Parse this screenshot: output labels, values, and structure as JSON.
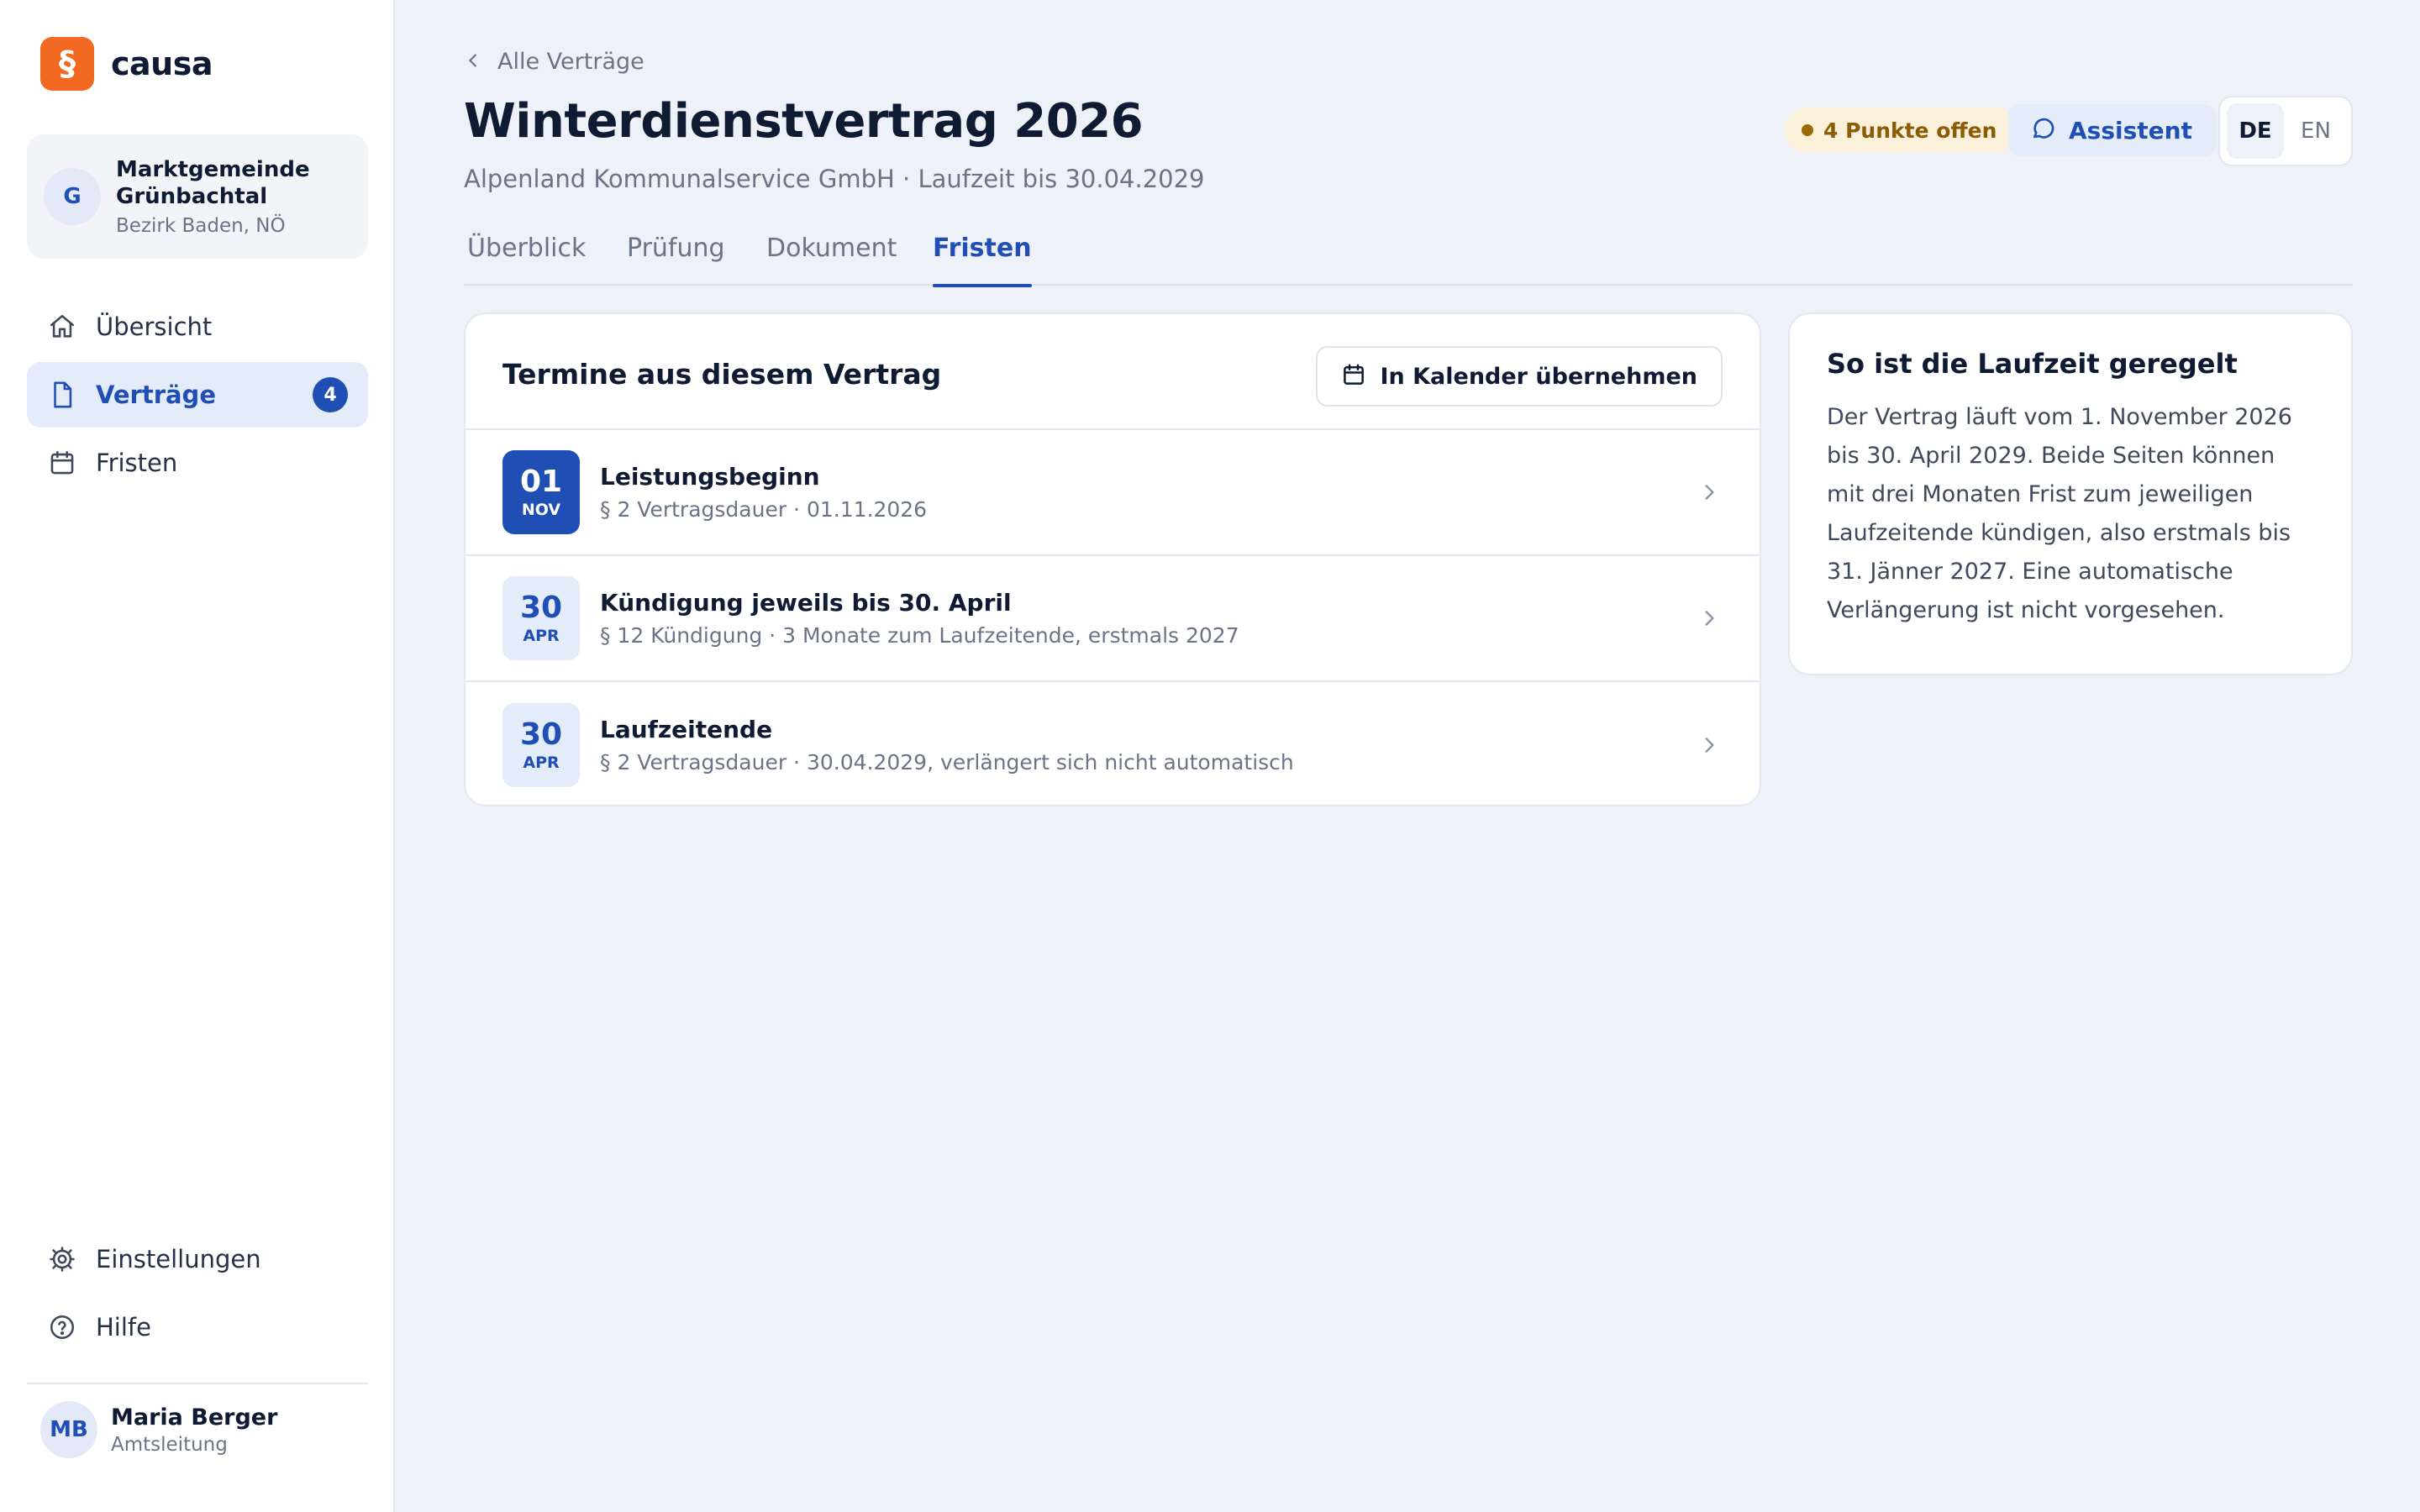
{
  "brand": {
    "mark": "§",
    "name": "causa",
    "accent": "#f26a21"
  },
  "org": {
    "initial": "G",
    "name": "Marktgemeinde Grünbachtal",
    "region": "Bezirk Baden, NÖ"
  },
  "nav": {
    "items": [
      {
        "label": "Übersicht",
        "icon": "home-icon"
      },
      {
        "label": "Verträge",
        "icon": "document-icon",
        "badge": "4",
        "active": true
      },
      {
        "label": "Fristen",
        "icon": "calendar-icon"
      }
    ],
    "bottom": [
      {
        "label": "Einstellungen",
        "icon": "gear-icon"
      },
      {
        "label": "Hilfe",
        "icon": "help-icon"
      }
    ]
  },
  "user": {
    "initials": "MB",
    "name": "Maria Berger",
    "role": "Amtsleitung"
  },
  "header": {
    "back_label": "Alle Verträge",
    "title": "Winterdienstvertrag 2026",
    "subtitle": "Alpenland Kommunalservice GmbH · Laufzeit bis 30.04.2029",
    "status": "4 Punkte offen",
    "assistant_label": "Assistent",
    "languages": [
      "DE",
      "EN"
    ],
    "active_language": "DE"
  },
  "tabs": [
    {
      "label": "Überblick"
    },
    {
      "label": "Prüfung"
    },
    {
      "label": "Dokument"
    },
    {
      "label": "Fristen",
      "active": true
    }
  ],
  "dates": {
    "title": "Termine aus diesem Vertrag",
    "calendar_button": "In Kalender übernehmen",
    "rows": [
      {
        "day": "01",
        "month": "NOV",
        "title": "Leistungsbeginn",
        "sub": "§ 2 Vertragsdauer · 01.11.2026",
        "highlight": true
      },
      {
        "day": "30",
        "month": "APR",
        "title": "Kündigung jeweils bis 30. April",
        "sub": "§ 12 Kündigung · 3 Monate zum Laufzeitende, erstmals 2027"
      },
      {
        "day": "30",
        "month": "APR",
        "title": "Laufzeitende",
        "sub": "§ 2 Vertragsdauer · 30.04.2029, verlängert sich nicht automatisch"
      }
    ]
  },
  "info": {
    "title": "So ist die Laufzeit geregelt",
    "body": "Der Vertrag läuft vom 1. November 2026 bis 30. April 2029. Beide Seiten können mit drei Monaten Frist zum jeweiligen Laufzeitende kündigen, also erstmals bis 31. Jänner 2027. Eine automatische Verlängerung ist nicht vorgesehen."
  },
  "colors": {
    "primary": "#1f4fb5",
    "warning_bg": "#fbf0d9",
    "warning_text": "#8a5d05"
  }
}
